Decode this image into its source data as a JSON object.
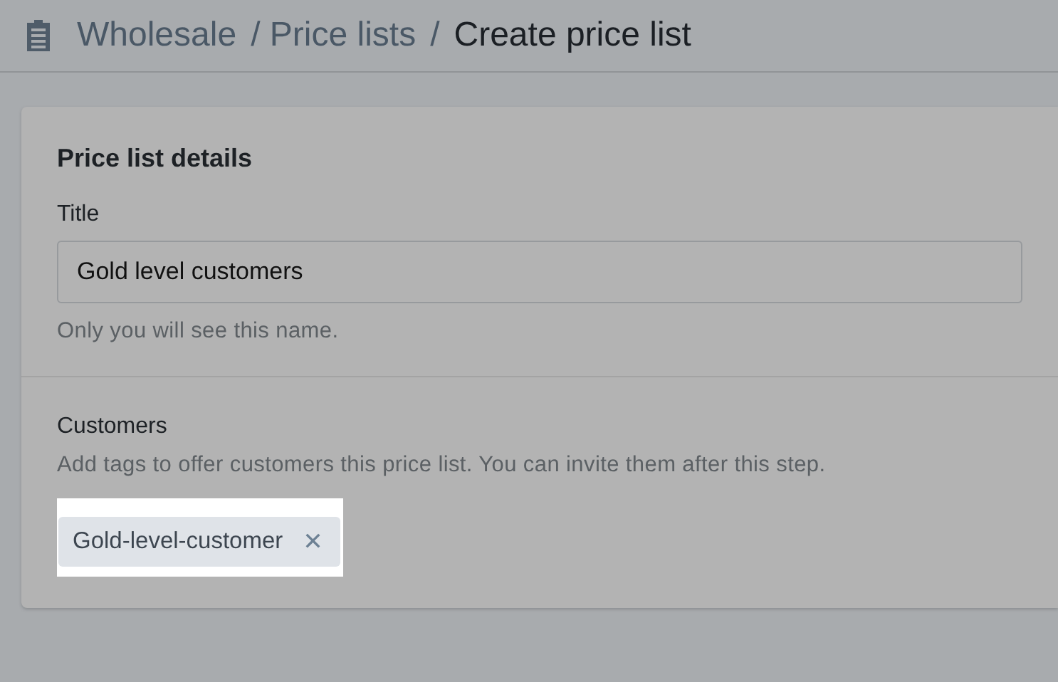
{
  "breadcrumb": [
    {
      "label": "Wholesale",
      "current": false
    },
    {
      "label": "/ Price lists",
      "current": false
    },
    {
      "label": "/",
      "current": false
    },
    {
      "label": "Create price list",
      "current": true
    }
  ],
  "card": {
    "heading": "Price list details",
    "title_field": {
      "label": "Title",
      "value": "Gold level customers",
      "help": "Only you will see this name."
    },
    "customers": {
      "label": "Customers",
      "description": "Add tags to offer customers this price list. You can invite them after this step.",
      "tags": [
        {
          "label": "Gold-level-customer",
          "remove": "✕",
          "highlighted": true
        }
      ]
    }
  }
}
